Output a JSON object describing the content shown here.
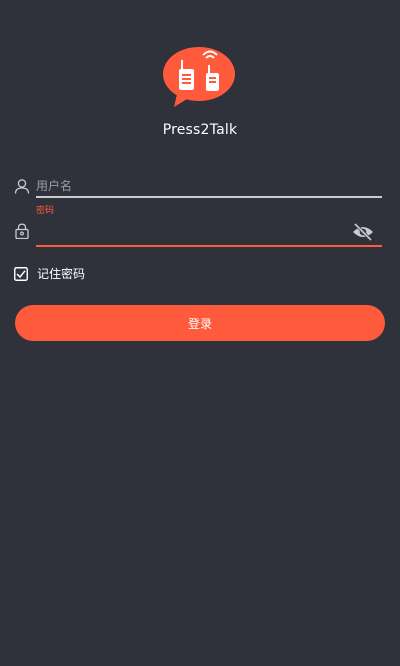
{
  "app": {
    "name": "Press2Talk",
    "logo_icon": "walkie-talkie-chat-bubble-icon"
  },
  "form": {
    "username": {
      "placeholder": "用户名",
      "value": "",
      "icon": "user-icon"
    },
    "password": {
      "label": "密码",
      "value": "",
      "icon": "lock-icon",
      "visibility_icon": "eye-off-icon"
    },
    "remember": {
      "label": "记住密码",
      "checked": true
    },
    "submit_label": "登录"
  },
  "colors": {
    "background": "#2f313b",
    "accent": "#ff5a3c",
    "text": "#ffffff",
    "muted": "#9a9ca5",
    "underline": "#c9cbd1"
  }
}
